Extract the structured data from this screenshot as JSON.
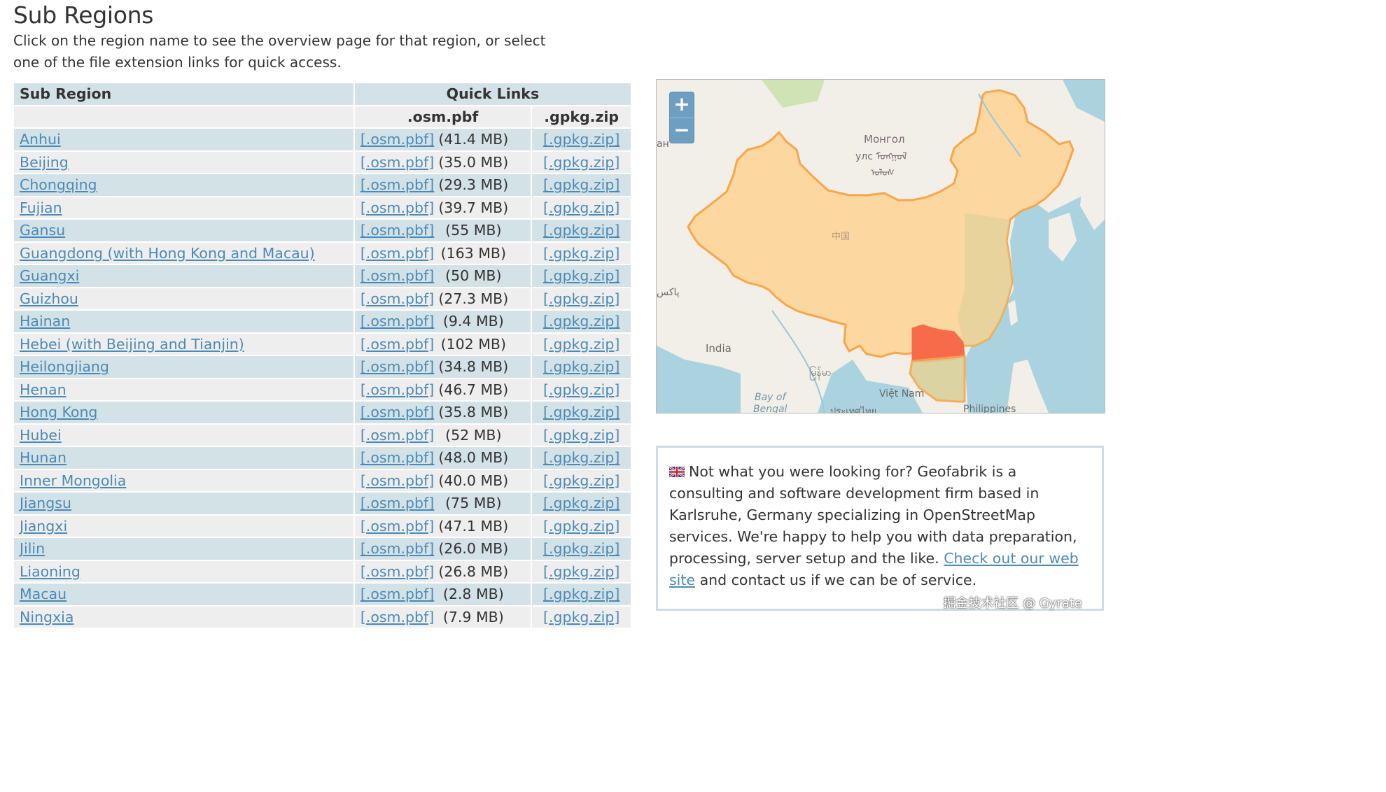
{
  "heading": "Sub Regions",
  "intro": "Click on the region name to see the overview page for that region, or select one of the file extension links for quick access.",
  "table": {
    "col_subregion": "Sub Region",
    "col_quicklinks": "Quick Links",
    "col_pbf": ".osm.pbf",
    "col_gpkg": ".gpkg.zip",
    "pbf_link": "[.osm.pbf]",
    "gpkg_link": "[.gpkg.zip]",
    "rows": [
      {
        "name": "Anhui",
        "size": "(41.4 MB)"
      },
      {
        "name": "Beijing",
        "size": "(35.0 MB)"
      },
      {
        "name": "Chongqing",
        "size": "(29.3 MB)"
      },
      {
        "name": "Fujian",
        "size": "(39.7 MB)"
      },
      {
        "name": "Gansu",
        "size": "(55 MB)"
      },
      {
        "name": "Guangdong (with Hong Kong and Macau)",
        "size": "(163 MB)"
      },
      {
        "name": "Guangxi",
        "size": "(50 MB)"
      },
      {
        "name": "Guizhou",
        "size": "(27.3 MB)"
      },
      {
        "name": "Hainan",
        "size": "(9.4 MB)"
      },
      {
        "name": "Hebei (with Beijing and Tianjin)",
        "size": "(102 MB)"
      },
      {
        "name": "Heilongjiang",
        "size": "(34.8 MB)"
      },
      {
        "name": "Henan",
        "size": "(46.7 MB)"
      },
      {
        "name": "Hong Kong",
        "size": "(35.8 MB)"
      },
      {
        "name": "Hubei",
        "size": "(52 MB)"
      },
      {
        "name": "Hunan",
        "size": "(48.0 MB)"
      },
      {
        "name": "Inner Mongolia",
        "size": "(40.0 MB)"
      },
      {
        "name": "Jiangsu",
        "size": "(75 MB)"
      },
      {
        "name": "Jiangxi",
        "size": "(47.1 MB)"
      },
      {
        "name": "Jilin",
        "size": "(26.0 MB)"
      },
      {
        "name": "Liaoning",
        "size": "(26.8 MB)"
      },
      {
        "name": "Macau",
        "size": "(2.8 MB)"
      },
      {
        "name": "Ningxia",
        "size": "(7.9 MB)"
      }
    ]
  },
  "map": {
    "zoom_in": "+",
    "zoom_out": "−",
    "labels": {
      "mongolia_1": "Монгол",
      "mongolia_2": "улс ᠮᠣᠩᠭᠣᠯ",
      "mongolia_3": "ᠤᠯᠤᠰ",
      "china": "中国",
      "pakistan": "پاکس",
      "india": "India",
      "myanmar": "မြန်မာ",
      "bay_1": "Bay of",
      "bay_2": "Bengal",
      "vietnam": "Việt Nam",
      "philippines": "Philippines",
      "thailand": "ประเทศไทย",
      "edge": "ан"
    },
    "colors": {
      "water": "#aad3df",
      "land": "#f2efe9",
      "china_fill": "#fdd7a0",
      "china_stroke": "#f7a64a",
      "selected_fill": "#f76a4a",
      "green": "#cfe3b4"
    }
  },
  "info": {
    "text": "Not what you were looking for? Geofabrik is a consulting and software development firm based in Karlsruhe, Germany specializing in OpenStreetMap services. We're happy to help you with data preparation, processing, server setup and the like.",
    "link": "Check out our web site",
    "tail": "and contact us if we can be of service.",
    "flag": "uk-flag-icon"
  },
  "watermark": "掘金技术社区 @ Gyrate"
}
